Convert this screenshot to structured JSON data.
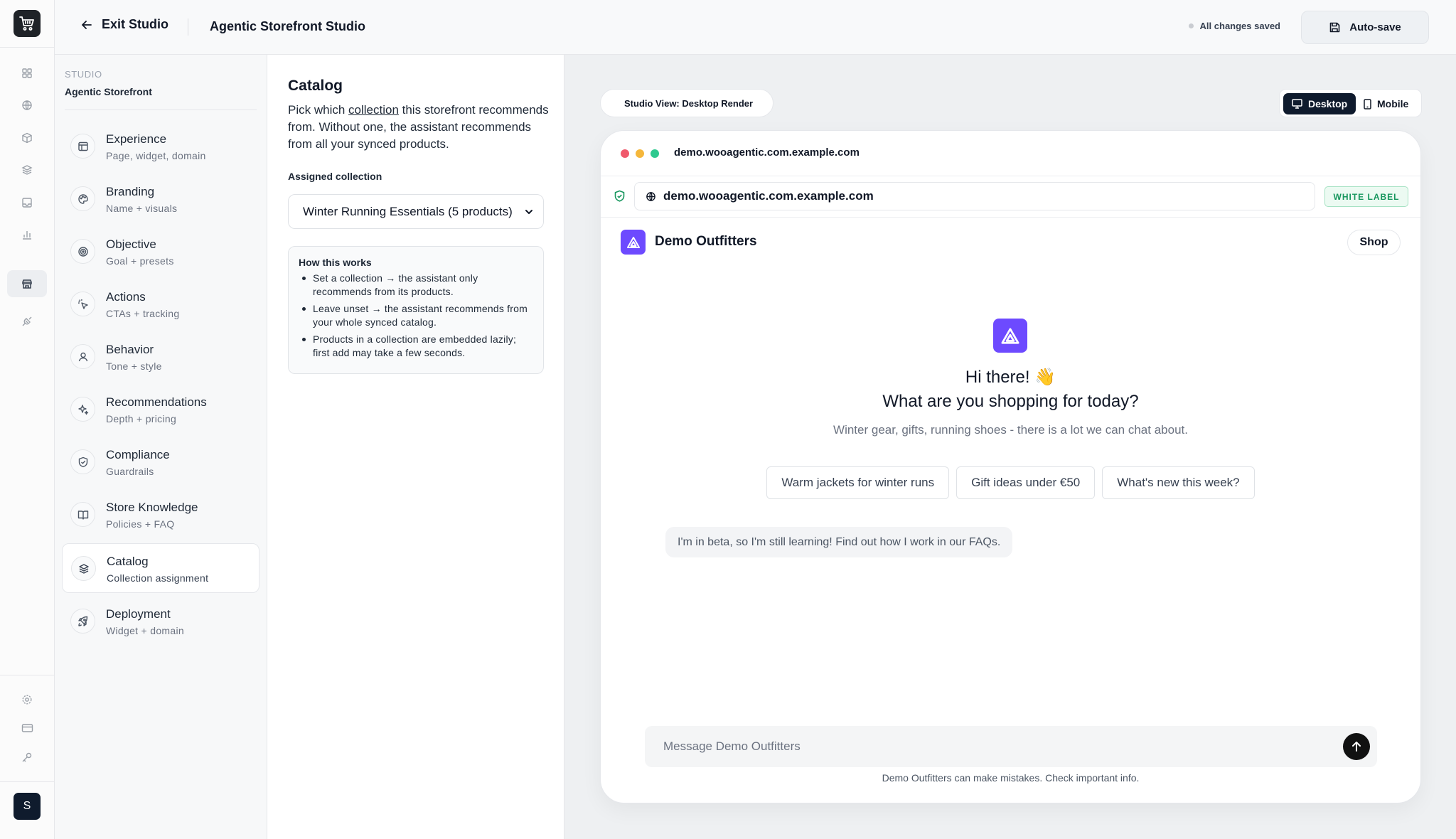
{
  "topbar": {
    "exit_label": "Exit Studio",
    "title": "Agentic Storefront Studio",
    "saved_status": "All changes saved",
    "autosave_label": "Auto-save"
  },
  "rail": {
    "avatar_initial": "S",
    "icons": [
      "dashboard-icon",
      "globe-icon",
      "package-icon",
      "layers-icon",
      "inbox-icon",
      "chart-icon",
      "storefront-icon",
      "plug-icon",
      "settings-icon",
      "card-icon",
      "key-icon"
    ]
  },
  "studio_nav": {
    "eyebrow": "STUDIO",
    "title": "Agentic Storefront",
    "items": [
      {
        "title": "Experience",
        "subtitle": "Page, widget, domain",
        "icon": "layout-icon"
      },
      {
        "title": "Branding",
        "subtitle": "Name + visuals",
        "icon": "palette-icon"
      },
      {
        "title": "Objective",
        "subtitle": "Goal + presets",
        "icon": "target-icon"
      },
      {
        "title": "Actions",
        "subtitle": "CTAs + tracking",
        "icon": "cursor-click-icon"
      },
      {
        "title": "Behavior",
        "subtitle": "Tone + style",
        "icon": "user-icon"
      },
      {
        "title": "Recommendations",
        "subtitle": "Depth + pricing",
        "icon": "sparkles-icon"
      },
      {
        "title": "Compliance",
        "subtitle": "Guardrails",
        "icon": "shield-check-icon"
      },
      {
        "title": "Store Knowledge",
        "subtitle": "Policies + FAQ",
        "icon": "book-icon"
      },
      {
        "title": "Catalog",
        "subtitle": "Collection assignment",
        "icon": "layers-icon"
      },
      {
        "title": "Deployment",
        "subtitle": "Widget + domain",
        "icon": "rocket-icon"
      }
    ],
    "active_index": 8
  },
  "catalog_panel": {
    "title": "Catalog",
    "desc_before": "Pick which ",
    "desc_link": "collection",
    "desc_after": " this storefront recommends from. Without one, the assistant recommends from all your synced products.",
    "field_label": "Assigned collection",
    "selected_collection": "Winter Running Essentials (5 products)",
    "how_title": "How this works",
    "how_items": [
      "Set a collection → the assistant only recommends from its products.",
      "Leave unset → the assistant recommends from your whole synced catalog.",
      "Products in a collection are embedded lazily; first add may take a few seconds."
    ]
  },
  "preview": {
    "view_label": "Studio View: Desktop Render",
    "toggle": {
      "desktop": "Desktop",
      "mobile": "Mobile",
      "active": "desktop"
    },
    "browser_host": "demo.wooagentic.com.example.com",
    "url": "demo.wooagentic.com.example.com",
    "badge": "WHITE LABEL",
    "store_name": "Demo Outfitters",
    "shop_label": "Shop",
    "greeting_line1": "Hi there! 👋",
    "greeting_line2": "What are you shopping for today?",
    "subtitle": "Winter gear, gifts, running shoes - there is a lot we can chat about.",
    "suggestions": [
      "Warm jackets for winter runs",
      "Gift ideas under €50",
      "What's new this week?"
    ],
    "beta_note": "I'm in beta, so I'm still learning! Find out how I work in our FAQs.",
    "composer_placeholder": "Message Demo Outfitters",
    "disclaimer": "Demo Outfitters can make mistakes. Check important info."
  },
  "colors": {
    "brand": "#6d4aff",
    "dark": "#0f1b2d",
    "traffic_red": "#f0596c",
    "traffic_yellow": "#f5b73b",
    "traffic_green": "#2ec98f",
    "badge_green": "#16965d"
  }
}
